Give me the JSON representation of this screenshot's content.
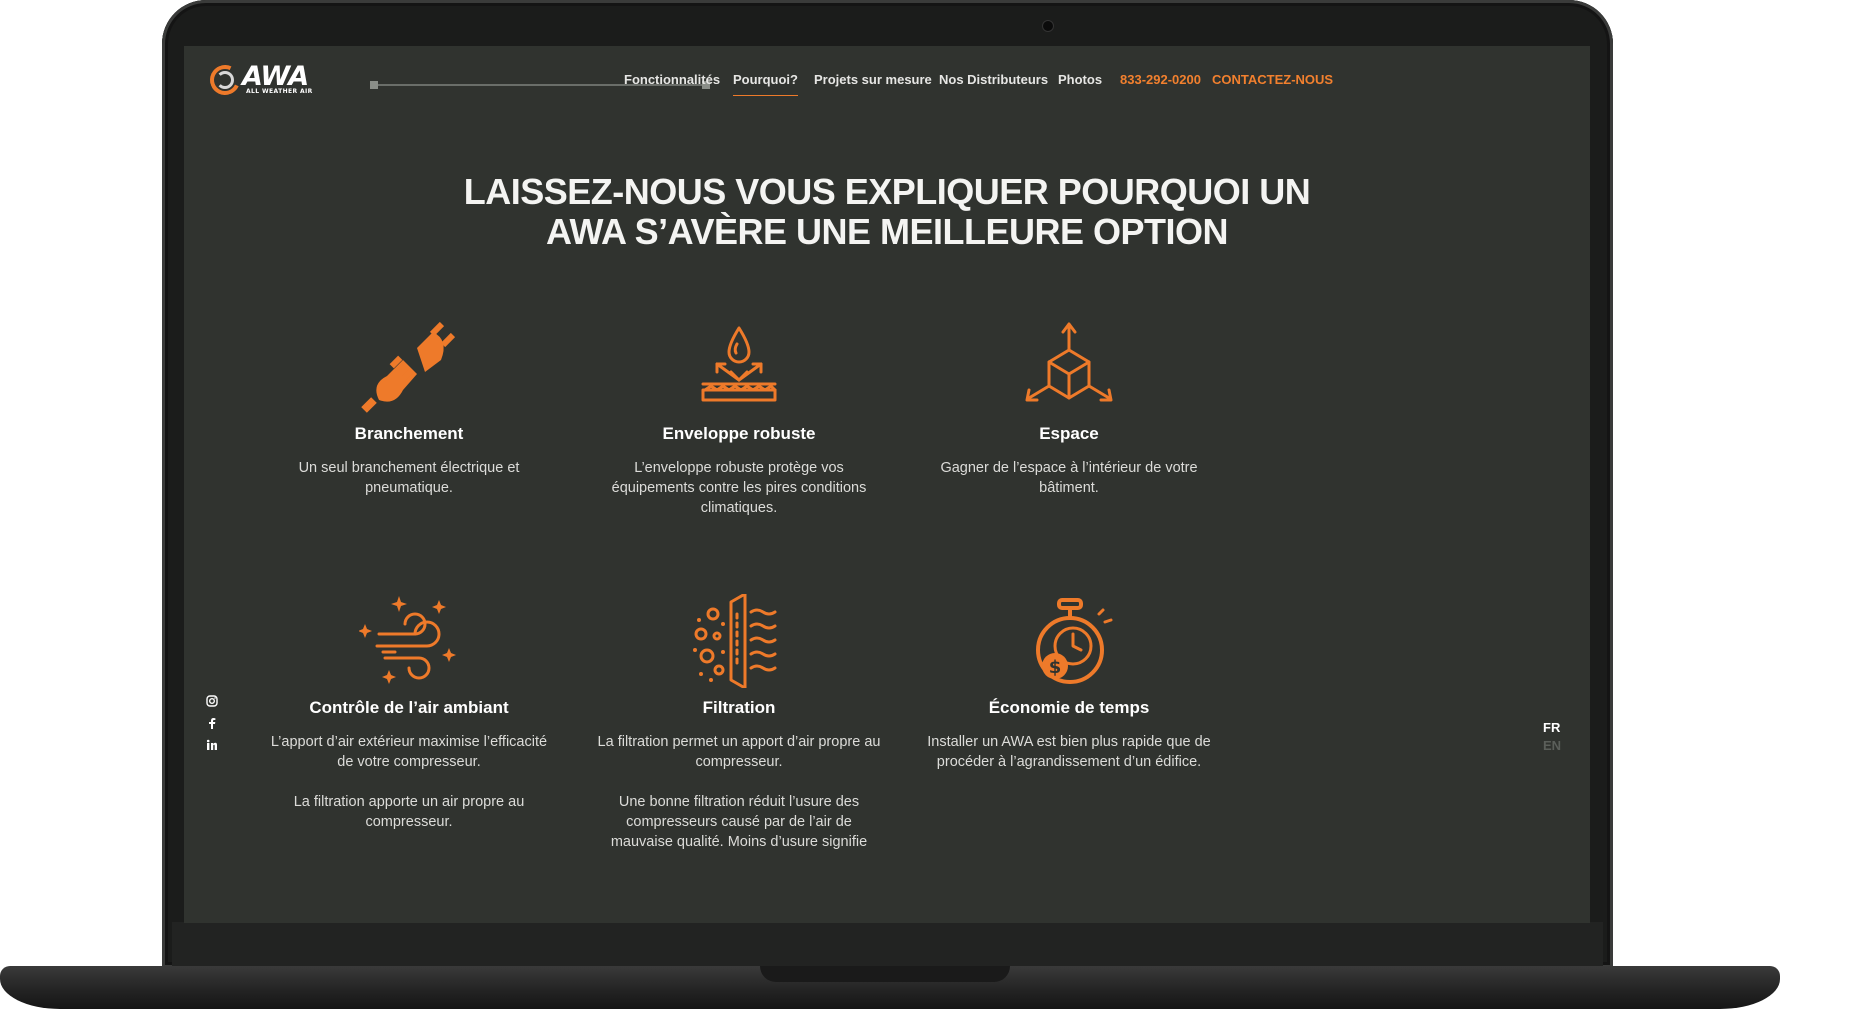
{
  "nav": {
    "logo_text": "AWA",
    "logo_sub": "ALL WEATHER AIR",
    "items": [
      {
        "label": "Fonctionnalités"
      },
      {
        "label": "Pourquoi?"
      },
      {
        "label": "Projets sur mesure"
      },
      {
        "label": "Nos Distributeurs"
      },
      {
        "label": "Photos"
      }
    ],
    "phone": "833-292-0200",
    "contact": "CONTACTEZ-NOUS"
  },
  "headline": {
    "line1": "LAISSEZ-NOUS VOUS EXPLIQUER POURQUOI UN",
    "line2": "AWA S’AVÈRE UNE MEILLEURE OPTION"
  },
  "features": [
    {
      "icon": "plug-icon",
      "title": "Branchement",
      "text": "Un seul branchement électrique et pneumatique."
    },
    {
      "icon": "water-shield-icon",
      "title": "Enveloppe robuste",
      "text": "L’enveloppe robuste protège vos équipements contre les pires conditions climatiques."
    },
    {
      "icon": "cube-expand-icon",
      "title": "Espace",
      "text": "Gagner de l’espace à l’intérieur de votre bâtiment."
    },
    {
      "icon": "wind-icon",
      "title": "Contrôle de l’air ambiant",
      "text": "L’apport d’air extérieur maximise l’efficacité de votre compresseur.",
      "text2": "La filtration apporte un air propre au compresseur."
    },
    {
      "icon": "filter-icon",
      "title": "Filtration",
      "text": "La filtration permet un apport d’air propre au compresseur.",
      "text2": "Une bonne filtration réduit l’usure des compresseurs causé par de l’air de mauvaise qualité. Moins d’usure signifie"
    },
    {
      "icon": "stopwatch-dollar-icon",
      "title": "Économie de temps",
      "text": "Installer un AWA est bien plus rapide que de procéder à l’agrandissement d’un édifice."
    }
  ],
  "social": [
    "instagram-icon",
    "facebook-icon",
    "linkedin-icon"
  ],
  "languages": {
    "fr": "FR",
    "en": "EN",
    "active": "FR"
  },
  "colors": {
    "accent": "#f2802e",
    "background": "#30332f",
    "text": "#ffffff"
  }
}
